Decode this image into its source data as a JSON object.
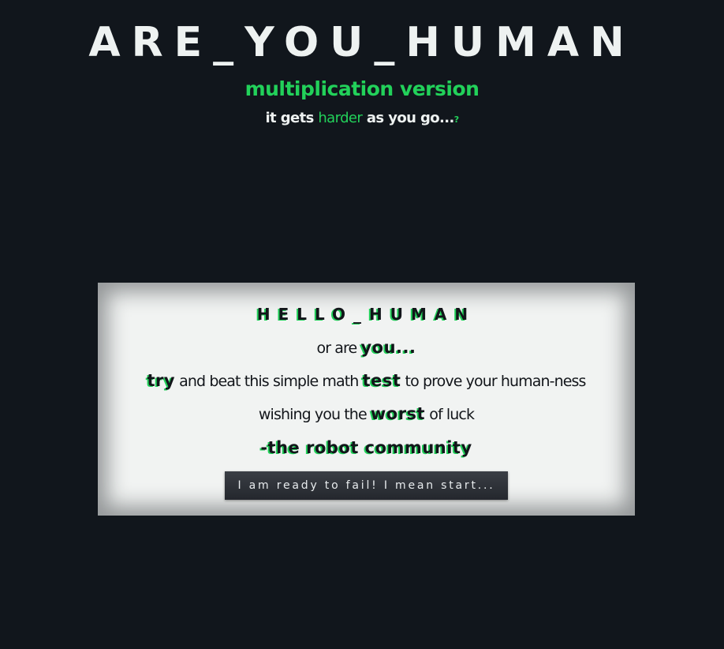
{
  "header": {
    "title": "ARE_YOU_HUMAN",
    "subtitle": "multiplication version",
    "tagline": {
      "part1": "it gets ",
      "highlight": "harder",
      "part2": " as you go...",
      "mark": "?"
    }
  },
  "card": {
    "title": "HELLO_HUMAN",
    "line1": {
      "text": "or are ",
      "em": "you..."
    },
    "line2": {
      "em1": "try",
      "text1": " and beat this simple math ",
      "em2": "test",
      "text2": " to prove your human-ness"
    },
    "line3": {
      "text1": "wishing you the ",
      "em": "worst",
      "text2": " of luck"
    },
    "signature": "-the robot community",
    "start_button_label": "I am ready to fail! I mean start..."
  },
  "colors": {
    "background": "#11161c",
    "accent": "#22d15a",
    "card": "#f1f3f2",
    "text_light": "#eef2f1",
    "text_dark": "#12151a"
  }
}
